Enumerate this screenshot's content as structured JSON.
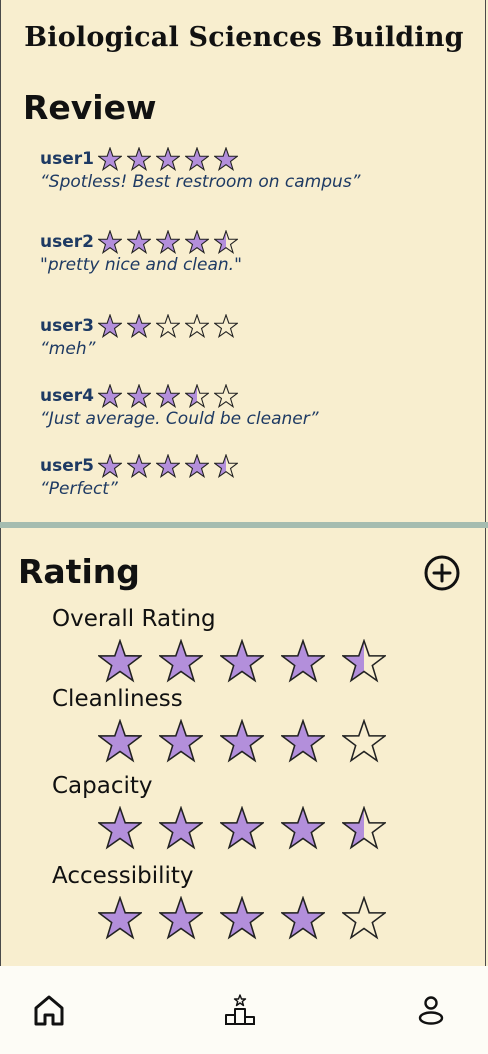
{
  "page": {
    "title": "Biological Sciences Building"
  },
  "reviews_section": {
    "heading": "Review",
    "items": [
      {
        "user": "user1",
        "rating": 5,
        "quote": "“Spotless! Best restroom on campus”"
      },
      {
        "user": "user2",
        "rating": 4.5,
        "quote": "\"pretty nice and clean.\""
      },
      {
        "user": "user3",
        "rating": 2,
        "quote": "“meh”"
      },
      {
        "user": "user4",
        "rating": 3.5,
        "quote": "“Just average. Could be cleaner”"
      },
      {
        "user": "user5",
        "rating": 4.5,
        "quote": "“Perfect”"
      }
    ]
  },
  "rating_section": {
    "heading": "Rating",
    "add_icon": "plus-circle-icon",
    "categories": [
      {
        "label": "Overall Rating",
        "rating": 4.5
      },
      {
        "label": "Cleanliness",
        "rating": 4
      },
      {
        "label": "Capacity",
        "rating": 4.5
      },
      {
        "label": "Accessibility",
        "rating": 4
      }
    ]
  },
  "bottom_nav": {
    "items": [
      {
        "icon": "home-icon"
      },
      {
        "icon": "leaderboard-icon"
      },
      {
        "icon": "profile-icon"
      }
    ]
  },
  "colors": {
    "background": "#f8eecf",
    "star_fill": "#b38fdb",
    "text_blue": "#1e3a63",
    "divider": "#a5bcb0"
  }
}
